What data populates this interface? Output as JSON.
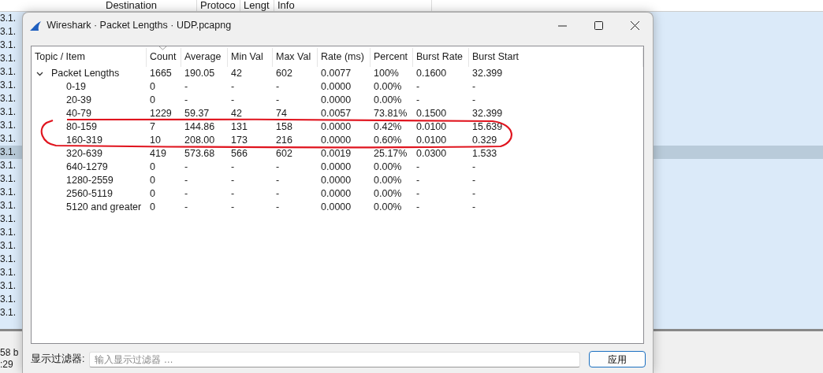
{
  "background": {
    "columns": [
      "Destination",
      "Protoco",
      "Lengt",
      "Info"
    ],
    "packet_rows": [
      {
        "text": "3.1.",
        "selected": false
      },
      {
        "text": "3.1.",
        "selected": false
      },
      {
        "text": "3.1.",
        "selected": false
      },
      {
        "text": "3.1.",
        "selected": false
      },
      {
        "text": "3.1.",
        "selected": false
      },
      {
        "text": "3.1.",
        "selected": false
      },
      {
        "text": "3.1.",
        "selected": false
      },
      {
        "text": "3.1.",
        "selected": false
      },
      {
        "text": "3.1.",
        "selected": false
      },
      {
        "text": "3.1.",
        "selected": false
      },
      {
        "text": "3.1.",
        "selected": true
      },
      {
        "text": "3.1.",
        "selected": false
      },
      {
        "text": "3.1.",
        "selected": false
      },
      {
        "text": "3.1.",
        "selected": false
      },
      {
        "text": "3.1.",
        "selected": false
      },
      {
        "text": "3.1.",
        "selected": false
      },
      {
        "text": "3.1.",
        "selected": false
      },
      {
        "text": "3.1.",
        "selected": false
      },
      {
        "text": "3.1.",
        "selected": false
      },
      {
        "text": "3.1.",
        "selected": false
      },
      {
        "text": "3.1.",
        "selected": false
      },
      {
        "text": "3.1.",
        "selected": false
      },
      {
        "text": "3.1.",
        "selected": false
      }
    ],
    "status_lines": [
      "58 b",
      ":29"
    ]
  },
  "window": {
    "title": "Wireshark · Packet Lengths · UDP.pcapng"
  },
  "tree": {
    "columns": [
      "Topic / Item",
      "Count",
      "Average",
      "Min Val",
      "Max Val",
      "Rate (ms)",
      "Percent",
      "Burst Rate",
      "Burst Start"
    ],
    "rows": [
      {
        "cells": [
          "Packet Lengths",
          "1665",
          "190.05",
          "42",
          "602",
          "0.0077",
          "100%",
          "0.1600",
          "32.399"
        ],
        "expanded": true,
        "children": [
          {
            "cells": [
              "0-19",
              "0",
              "-",
              "-",
              "-",
              "0.0000",
              "0.00%",
              "-",
              "-"
            ]
          },
          {
            "cells": [
              "20-39",
              "0",
              "-",
              "-",
              "-",
              "0.0000",
              "0.00%",
              "-",
              "-"
            ]
          },
          {
            "cells": [
              "40-79",
              "1229",
              "59.37",
              "42",
              "74",
              "0.0057",
              "73.81%",
              "0.1500",
              "32.399"
            ]
          },
          {
            "cells": [
              "80-159",
              "7",
              "144.86",
              "131",
              "158",
              "0.0000",
              "0.42%",
              "0.0100",
              "15.639"
            ]
          },
          {
            "cells": [
              "160-319",
              "10",
              "208.00",
              "173",
              "216",
              "0.0000",
              "0.60%",
              "0.0100",
              "0.329"
            ]
          },
          {
            "cells": [
              "320-639",
              "419",
              "573.68",
              "566",
              "602",
              "0.0019",
              "25.17%",
              "0.0300",
              "1.533"
            ]
          },
          {
            "cells": [
              "640-1279",
              "0",
              "-",
              "-",
              "-",
              "0.0000",
              "0.00%",
              "-",
              "-"
            ]
          },
          {
            "cells": [
              "1280-2559",
              "0",
              "-",
              "-",
              "-",
              "0.0000",
              "0.00%",
              "-",
              "-"
            ]
          },
          {
            "cells": [
              "2560-5119",
              "0",
              "-",
              "-",
              "-",
              "0.0000",
              "0.00%",
              "-",
              "-"
            ]
          },
          {
            "cells": [
              "5120 and greater",
              "0",
              "-",
              "-",
              "-",
              "0.0000",
              "0.00%",
              "-",
              "-"
            ]
          }
        ]
      }
    ]
  },
  "filter": {
    "label": "显示过滤器:",
    "placeholder": "输入显示过滤器 …",
    "button": "应用"
  }
}
